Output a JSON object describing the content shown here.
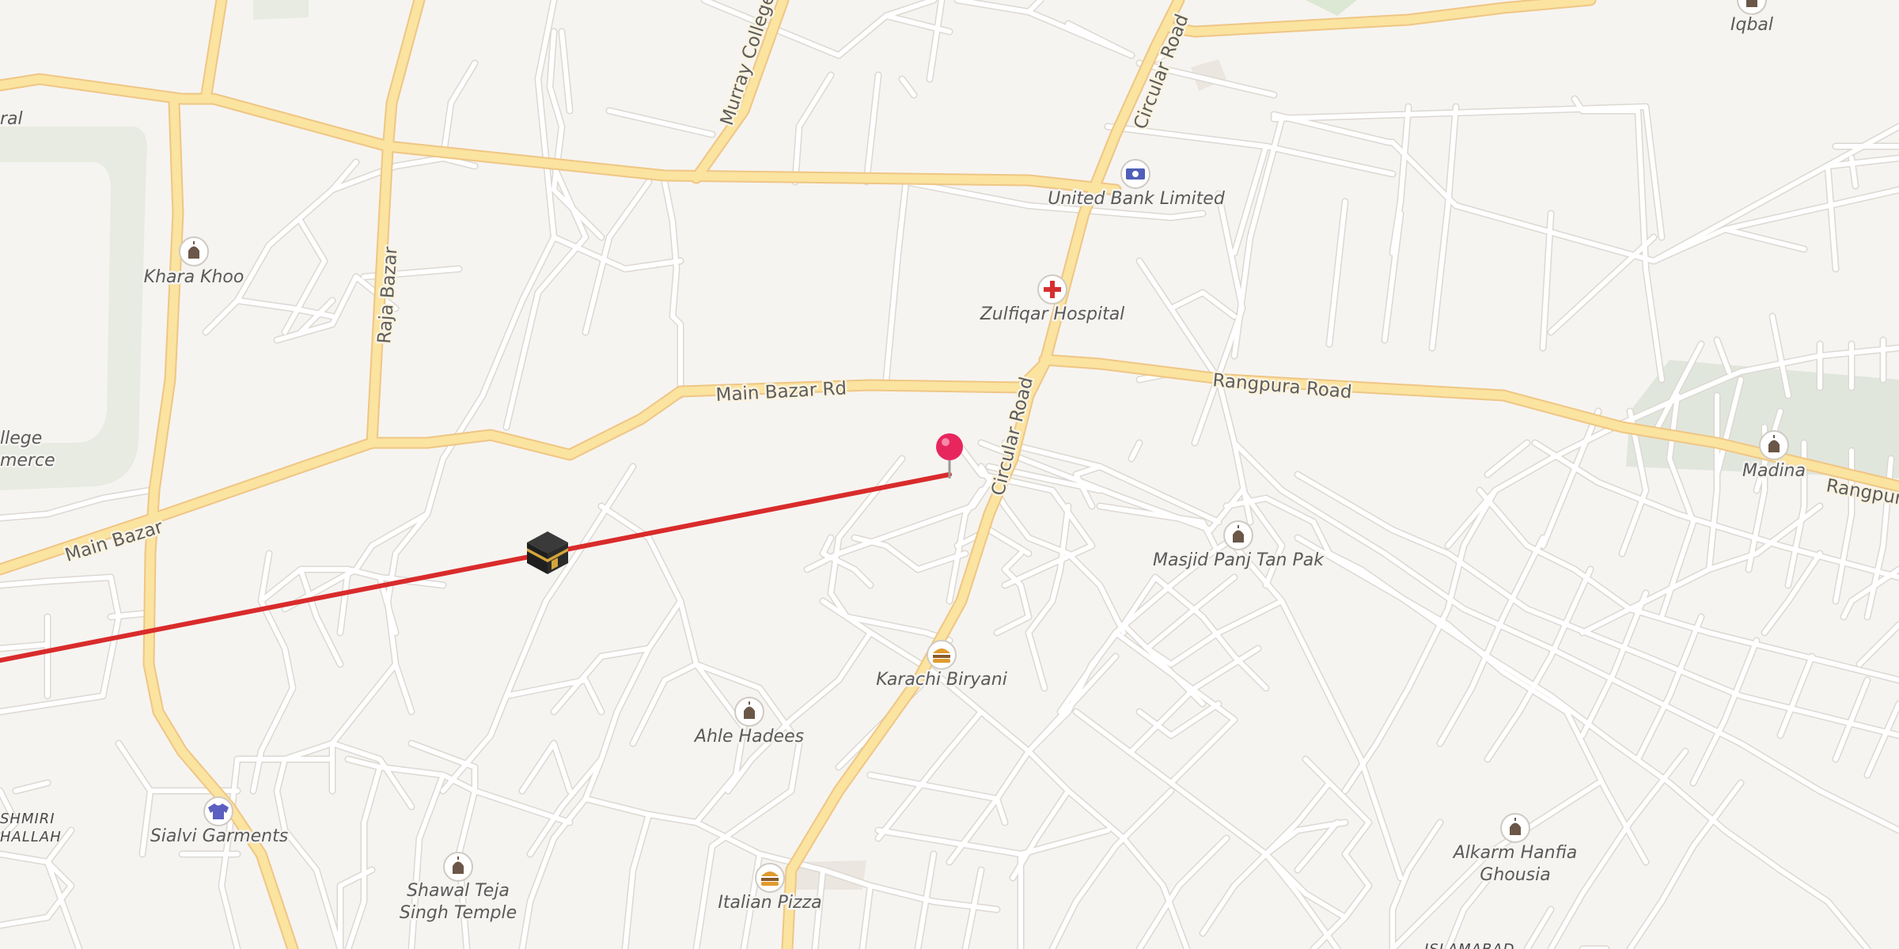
{
  "map": {
    "roads": {
      "main_bazar_rd": "Main Bazar Rd",
      "main_bazar": "Main Bazar",
      "raja_bazar": "Raja Bazar",
      "murray_college": "Murray College",
      "circular_road_north": "Circular Road",
      "circular_road_south": "Circular Road",
      "rangpura_road": "Rangpura Road",
      "rangpur_edge": "Rangpur"
    },
    "pois": [
      {
        "name": "Khara Khoo",
        "icon": "mosque-icon"
      },
      {
        "name": "United Bank Limited",
        "icon": "bank-icon"
      },
      {
        "name": "Zulfiqar Hospital",
        "icon": "hospital-icon"
      },
      {
        "name": "Masjid Panj Tan Pak",
        "icon": "mosque-icon"
      },
      {
        "name": "Karachi Biryani",
        "icon": "fastfood-icon"
      },
      {
        "name": "Ahle Hadees",
        "icon": "mosque-icon"
      },
      {
        "name": "Sialvi Garments",
        "icon": "clothing-icon"
      },
      {
        "name": "Shawal Teja",
        "icon": "mosque-icon"
      },
      {
        "name": "Italian Pizza",
        "icon": "fastfood-icon"
      },
      {
        "name": "Madina",
        "icon": "mosque-icon"
      },
      {
        "name": "Iqbal",
        "icon": "mosque-icon"
      },
      {
        "name": "Alkarm Hanfia",
        "icon": "mosque-icon"
      }
    ],
    "poi_extra": {
      "shawal_line2": "Singh Temple",
      "alkarm_line2": "Ghousia"
    },
    "edge_labels": {
      "ral": "ral",
      "llege": "llege",
      "merce": "merce",
      "shmiri": "SHMIRI",
      "hallah": "HALLAH",
      "islamabad": "ISLAMABAD"
    },
    "markers": {
      "pin": "location-pin-icon",
      "kaaba": "kaaba-icon"
    },
    "colors": {
      "background": "#f6f4f1",
      "major_road": "#fbe3a0",
      "major_road_casing": "#f0c27a",
      "minor_road": "#ffffff",
      "minor_road_casing": "#dcd8d2",
      "park": "#e7ebe1",
      "qibla_line": "#d92b2b",
      "pin": "#e8265e"
    }
  }
}
